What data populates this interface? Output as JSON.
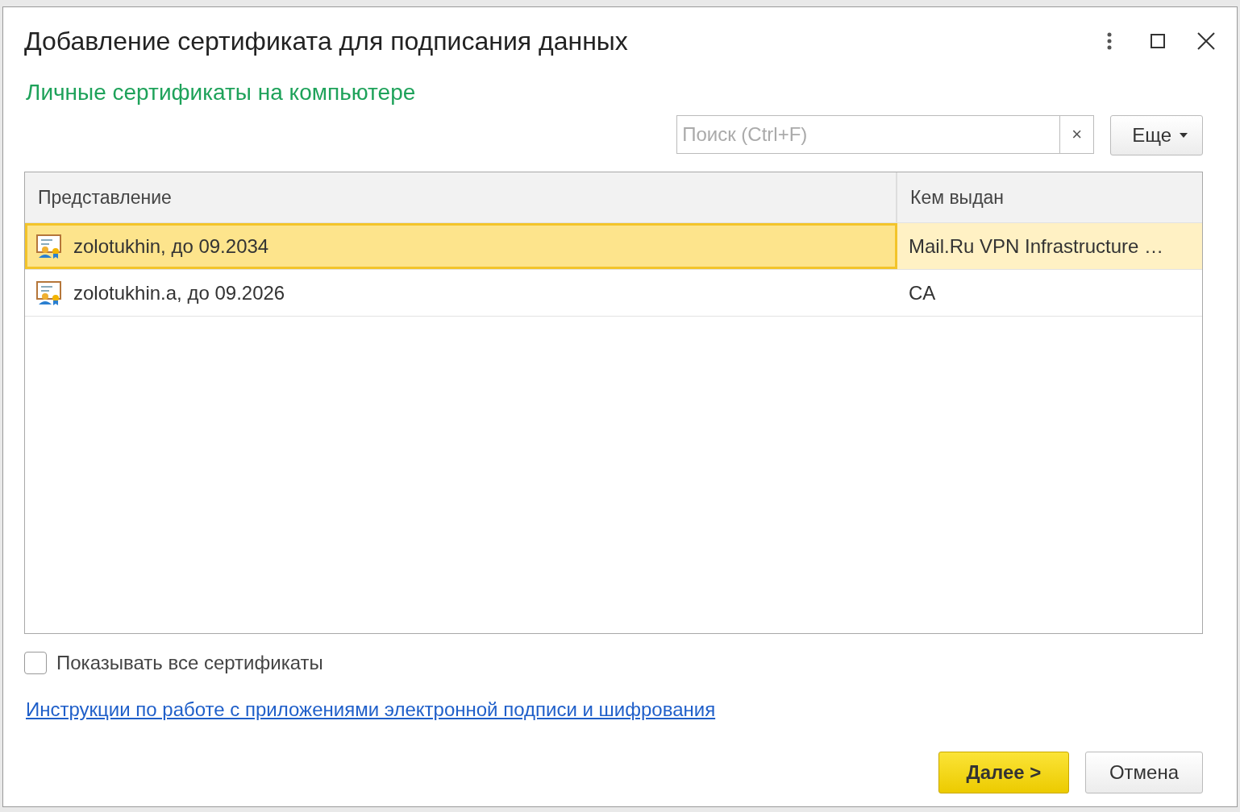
{
  "window": {
    "title": "Добавление сертификата для подписания данных"
  },
  "subtitle": "Личные сертификаты на компьютере",
  "search": {
    "placeholder": "Поиск (Ctrl+F)",
    "clear": "×"
  },
  "more_button": "Еще",
  "table": {
    "columns": [
      "Представление",
      "Кем выдан"
    ],
    "rows": [
      {
        "name": "zolotukhin, до 09.2034",
        "issuer": "Mail.Ru VPN Infrastructure …",
        "selected": true
      },
      {
        "name": "zolotukhin.a, до 09.2026",
        "issuer": "CA",
        "selected": false
      }
    ]
  },
  "show_all": {
    "label": "Показывать все сертификаты",
    "checked": false
  },
  "link": "Инструкции по работе с приложениями электронной подписи и шифрования",
  "buttons": {
    "next": "Далее >",
    "cancel": "Отмена"
  }
}
